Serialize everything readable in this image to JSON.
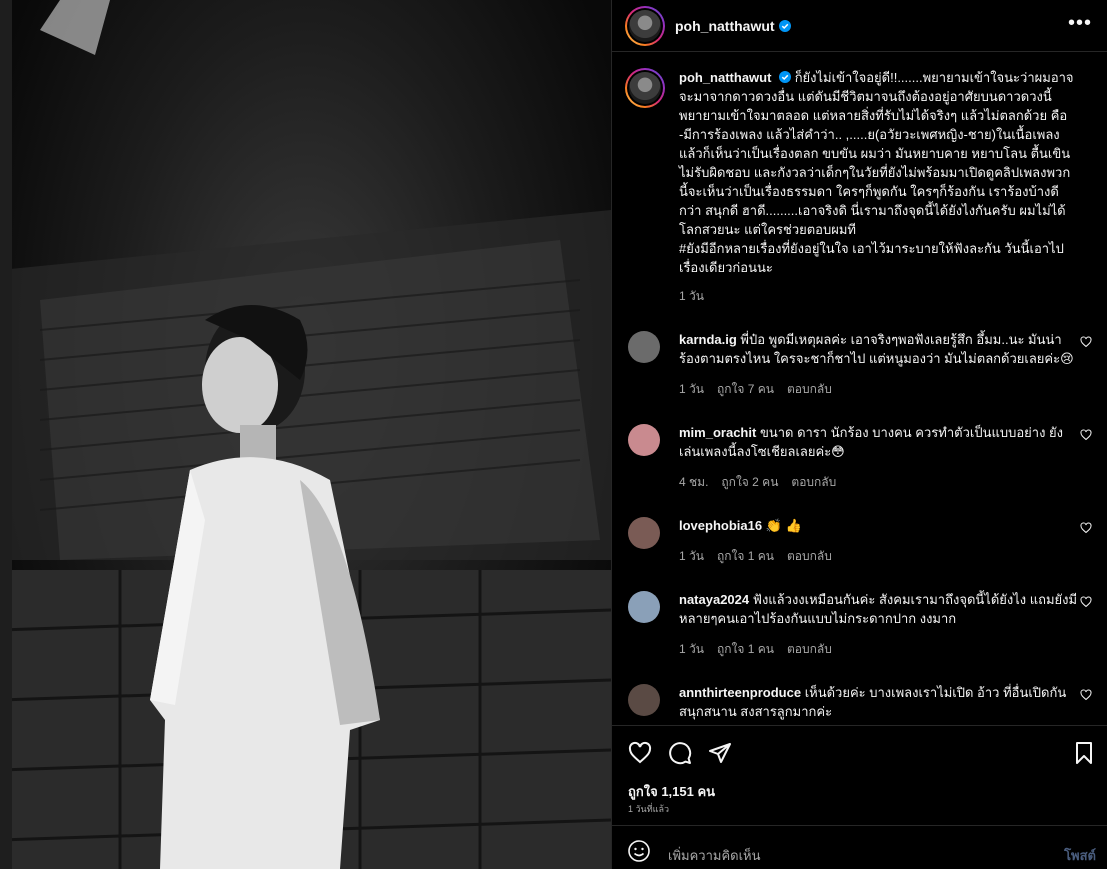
{
  "post": {
    "username": "poh_natthawut",
    "caption": "ก็ยังไม่เข้าใจอยู่ดี!!.......พยายามเข้าใจนะว่าผมอาจจะมาจากดาวดวงอื่น แต่ดันมีชีวิตมาจนถึงต้องอยู่อาศัยบนดาวดวงนี้ พยายามเข้าใจมาตลอด แต่หลายสิ่งที่รับไม่ได้จริงๆ แล้วไม่ตลกด้วย คือ -มีการร้องเพลง แล้วไส่คำว่า.. ,.....ย(อวัยวะเพศหญิง-ชาย)ในเนื้อเพลง แล้วก็เห็นว่าเป็นเรื่องตลก ขบขัน ผมว่า มันหยาบคาย หยาบโลน ตื้นเขิน ไม่รับผิดชอบ และกังวลว่าเด็กๆในวัยที่ยังไม่พร้อมมาเปิดดูคลิปเพลงพวกนี้จะเห็นว่าเป็นเรื่องธรรมดา ใครๆก็พูดกัน ใครๆก็ร้องกัน เราร้องบ้างดีกว่า สนุกดี ฮาดี.........เอาจริงดิ นี่เรามาถึงจุดนี้ได้ยังไงกันครับ ผมไม่ได้โลกสวยนะ แต่ใครช่วยตอบผมที",
    "caption_tag": "#ยังมีอีกหลายเรื่องที่ยังอยู่ในใจ เอาไว้มาระบายให้ฟังละกัน วันนี้เอาไปเรื่องเดียวก่อนนะ",
    "caption_age": "1 วัน",
    "likes": "ถูกใจ 1,151 คน",
    "posted": "1 วันที่แล้ว",
    "add_comment_placeholder": "เพิ่มความคิดเห็น",
    "post_button": "โพสต์"
  },
  "comments": [
    {
      "user": "karnda.ig",
      "text": "พี่ป๋อ พูดมีเหตุผลค่ะ เอาจริงๆพอฟังเลยรู้สึก อึ้มม..นะ มันน่าร้องตามตรงไหน ใครจะชาก็ชาไป แต่หนูมองว่า มันไม่ตลกด้วยเลยค่ะ😢",
      "age": "1 วัน",
      "likes": "ถูกใจ 7 คน",
      "reply": "ตอบกลับ",
      "avatar_color": "#6b6b6b"
    },
    {
      "user": "mim_orachit",
      "text": "ขนาด ดารา นักร้อง บางคน ควรทำตัวเป็นแบบอย่าง ยังเล่นเพลงนี้ลงโซเชียลเลยค่ะ😳",
      "age": "4 ชม.",
      "likes": "ถูกใจ 2 คน",
      "reply": "ตอบกลับ",
      "avatar_color": "#c98a8f"
    },
    {
      "user": "lovephobia16",
      "text": "👏 👍",
      "age": "1 วัน",
      "likes": "ถูกใจ 1 คน",
      "reply": "ตอบกลับ",
      "avatar_color": "#7a5b55"
    },
    {
      "user": "nataya2024",
      "text": "ฟังแล้วงงเหมือนกันค่ะ สังคมเรามาถึงจุดนี้ได้ยังไง แถมยังมีหลายๆคนเอาไปร้องกันแบบไม่กระดากปาก งงมาก",
      "age": "1 วัน",
      "likes": "ถูกใจ 1 คน",
      "reply": "ตอบกลับ",
      "avatar_color": "#8aa0b8"
    },
    {
      "user": "annthirteenproduce",
      "text": "เห็นด้วยค่ะ บางเพลงเราไม่เปิด อ้าว ที่อื่นเปิดกันสนุกสนาน สงสารลูกมากค่ะ",
      "age": "",
      "likes": "",
      "reply": "",
      "avatar_color": "#5a4a44"
    }
  ],
  "icons": {
    "more": "more-options-icon",
    "verified": "verified-badge-icon",
    "like": "heart-icon",
    "comment": "comment-icon",
    "share": "share-icon",
    "save": "bookmark-icon",
    "emoji": "emoji-icon",
    "verified_color": "#0095f6"
  }
}
